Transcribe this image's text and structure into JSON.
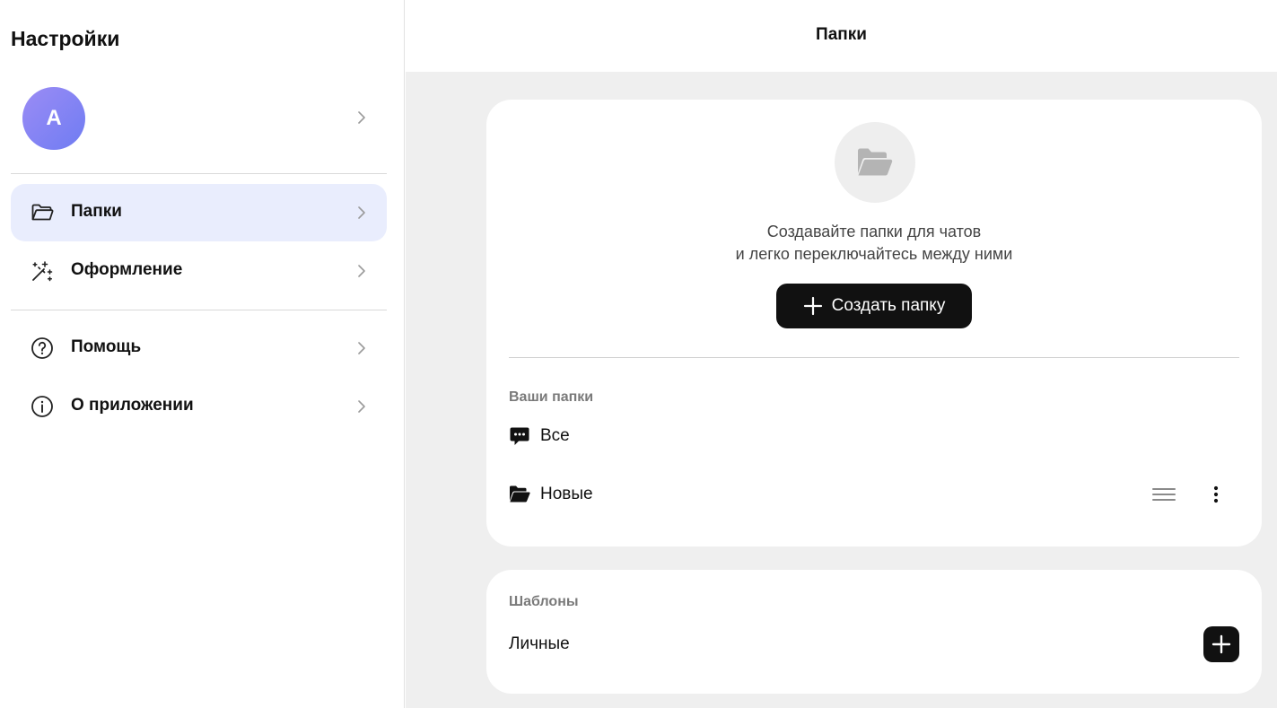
{
  "sidebar": {
    "title": "Настройки",
    "profile": {
      "avatar_letter": "A"
    },
    "items": [
      {
        "label": "Папки",
        "icon": "folder-icon",
        "active": true
      },
      {
        "label": "Оформление",
        "icon": "magic-wand-icon"
      },
      {
        "label": "Помощь",
        "icon": "question-circle-icon"
      },
      {
        "label": "О приложении",
        "icon": "info-circle-icon"
      }
    ]
  },
  "main": {
    "header": {
      "title": "Папки"
    },
    "intro": {
      "line1": "Создавайте папки для чатов",
      "line2": "и легко переключайтесь между ними",
      "create_button": "Создать папку"
    },
    "folders": {
      "label": "Ваши папки",
      "items": [
        {
          "name": "Все",
          "icon": "chat-bubble-icon"
        },
        {
          "name": "Новые",
          "icon": "folder-open-icon"
        }
      ]
    },
    "templates": {
      "label": "Шаблоны",
      "items": [
        {
          "name": "Личные"
        }
      ]
    }
  },
  "colors": {
    "accent_active": "#e9edfd",
    "button_dark": "#111111",
    "avatar_gradient_start": "#9b8cf5",
    "avatar_gradient_end": "#6f7cf2",
    "page_bg": "#efefef"
  }
}
